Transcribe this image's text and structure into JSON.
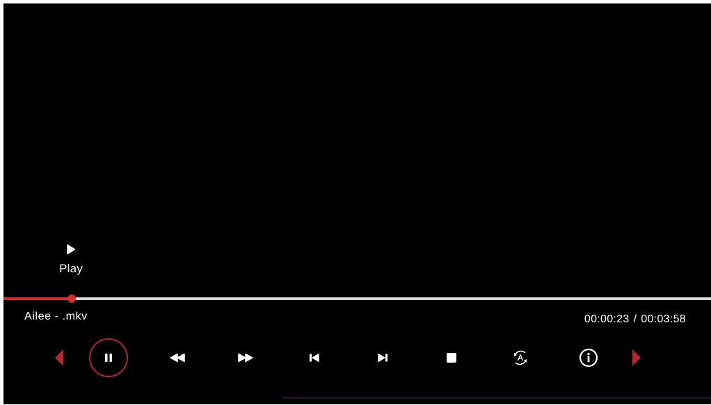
{
  "player": {
    "status_label": "Play",
    "filename": "Ailee - .mkv",
    "time": {
      "current": "00:00:23",
      "separator": "/",
      "total": "00:03:58"
    },
    "progress_fraction": 0.096,
    "colors": {
      "accent": "#e02626",
      "track": "#d9d9d9",
      "background": "#000000",
      "icon": "#ffffff"
    }
  },
  "controls": [
    {
      "name": "prev-page-arrow-icon"
    },
    {
      "name": "pause-icon",
      "state": "selected"
    },
    {
      "name": "rewind-icon"
    },
    {
      "name": "fast-forward-icon"
    },
    {
      "name": "skip-previous-icon"
    },
    {
      "name": "skip-next-icon"
    },
    {
      "name": "stop-icon"
    },
    {
      "name": "audio-track-icon"
    },
    {
      "name": "info-icon"
    },
    {
      "name": "next-page-arrow-icon"
    }
  ]
}
